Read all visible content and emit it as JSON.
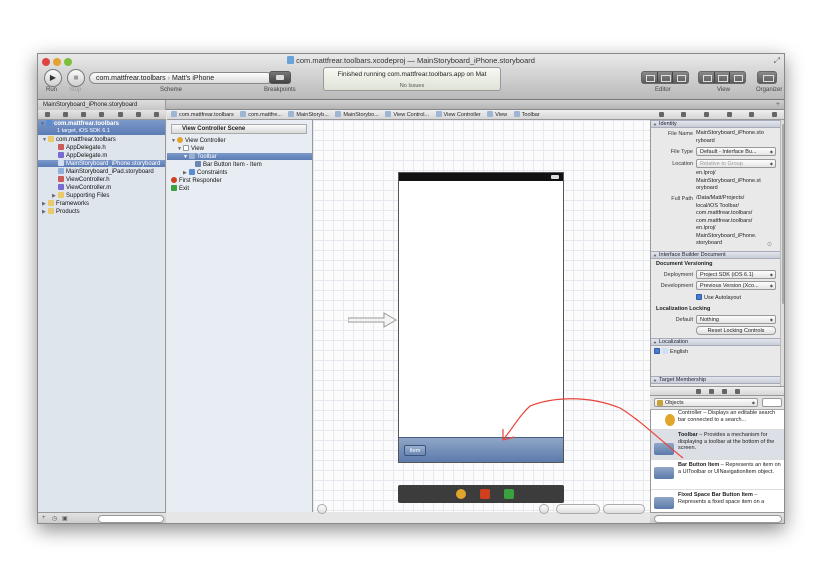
{
  "window": {
    "title": "com.mattfrear.toolbars.xcodeproj — MainStoryboard_iPhone.storyboard"
  },
  "toolbar": {
    "scheme_target": "com.mattfrear.toolbars",
    "scheme_device": "Matt's iPhone",
    "run_label": "Run",
    "stop_label": "Stop",
    "scheme_label": "Scheme",
    "breakpoints_label": "Breakpoints",
    "editor_label": "Editor",
    "view_label": "View",
    "organizer_label": "Organizer",
    "activity_status": "Finished running com.mattfrear.toolbars.app on Mat",
    "activity_issues": "No Issues"
  },
  "tabs": [
    {
      "label": "MainStoryboard_iPhone.storyboard"
    }
  ],
  "navigator": {
    "project_name": "com.mattfrear.toolbars",
    "project_sub": "1 target, iOS SDK 6.1",
    "items": [
      {
        "label": "com.mattfrear.toolbars"
      },
      {
        "label": "AppDelegate.h"
      },
      {
        "label": "AppDelegate.m"
      },
      {
        "label": "MainStoryboard_iPhone.storyboard"
      },
      {
        "label": "MainStoryboard_iPad.storyboard"
      },
      {
        "label": "ViewController.h"
      },
      {
        "label": "ViewController.m"
      },
      {
        "label": "Supporting Files"
      },
      {
        "label": "Frameworks"
      },
      {
        "label": "Products"
      }
    ]
  },
  "jumpbar": {
    "crumbs": [
      "com.mattfrear.toolbars",
      "com.mattfre...",
      "MainStoryb...",
      "MainStorybo...",
      "View Control...",
      "View Controller",
      "View",
      "Toolbar"
    ]
  },
  "outline": {
    "header": "View Controller Scene",
    "items": [
      {
        "label": "View Controller"
      },
      {
        "label": "View"
      },
      {
        "label": "Toolbar"
      },
      {
        "label": "Bar Button Item - Item"
      },
      {
        "label": "Constraints"
      },
      {
        "label": "First Responder"
      },
      {
        "label": "Exit"
      }
    ]
  },
  "canvas": {
    "toolbar_item_label": "Item"
  },
  "inspector": {
    "identity_header": "Identity",
    "file_name_label": "File Name",
    "file_name_value": "MainStoryboard_iPhone.storyboard",
    "file_name_l1": "MainStoryboard_iPhone.sto",
    "file_name_l2": "ryboard",
    "file_type_label": "File Type",
    "file_type_value": "Default - Interface Bu...",
    "location_label": "Location",
    "location_value": "Relative to Group",
    "location_path_1": "en.lproj/",
    "location_path_2": "MainStoryboard_iPhone.st",
    "location_path_3": "oryboard",
    "full_path_label": "Full Path",
    "full_path_1": "/Data/Matt/Projects/",
    "full_path_2": "local/iOS Toolbar/",
    "full_path_3": "com.mattfrear.toolbars/",
    "full_path_4": "com.mattfrear.toolbars/",
    "full_path_5": "en.lproj/",
    "full_path_6": "MainStoryboard_iPhone.",
    "full_path_7": "storyboard",
    "ib_doc_header": "Interface Builder Document",
    "doc_versioning_label": "Document Versioning",
    "deployment_label": "Deployment",
    "deployment_value": "Project SDK (iOS 6.1)",
    "development_label": "Development",
    "development_value": "Previous Version (Xco...",
    "autolayout_label": "Use Autolayout",
    "loc_locking_label": "Localization Locking",
    "default_label": "Default",
    "default_value": "Nothing",
    "reset_locking_label": "Reset Locking Controls",
    "localization_header": "Localization",
    "english_label": "English",
    "target_membership_header": "Target Membership"
  },
  "library": {
    "selector_value": "Objects",
    "items": [
      {
        "title": "",
        "desc": "Controller – Displays an editable search bar connected to a search..."
      },
      {
        "title": "Toolbar",
        "desc": " – Provides a mechanism for displaying a toolbar at the bottom of the screen."
      },
      {
        "title": "Bar Button Item",
        "desc": " – Represents an item on a UIToolbar or UINavigationItem object."
      },
      {
        "title": "Fixed Space Bar Button Item",
        "desc": " – Represents a fixed space item on a"
      }
    ]
  },
  "colors": {
    "selection": "#5b7cb5",
    "toolbar_blue": "#6f8cb8",
    "annotation_red": "#e8443a"
  }
}
